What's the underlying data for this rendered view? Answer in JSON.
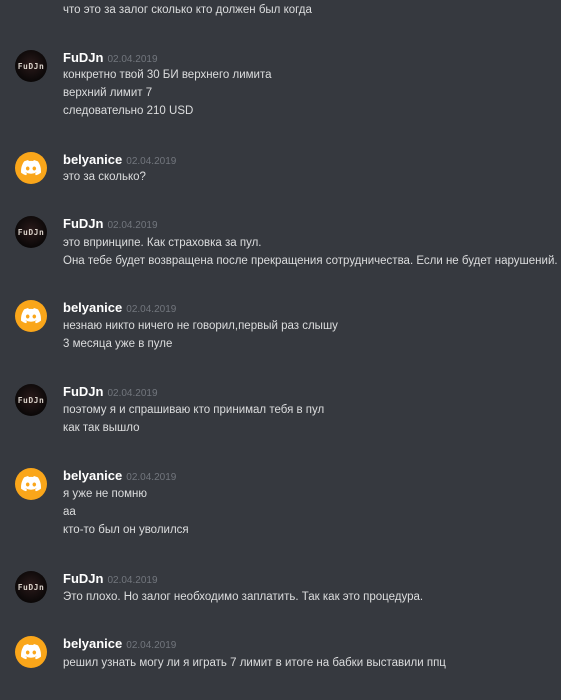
{
  "chat": {
    "top_partial_line": "что это за залог сколько кто должен был когда",
    "messages": [
      {
        "author": "FuDJn",
        "avatar_text": "FuDJn",
        "date": "02.04.2019",
        "lines": [
          "конкретно твой 30  БИ верхнего лимита",
          "верхний лимит 7",
          "следовательно 210 USD"
        ]
      },
      {
        "author": "belyanice",
        "avatar_icon": "discord-logo-icon",
        "date": "02.04.2019",
        "lines": [
          "это за сколько?"
        ]
      },
      {
        "author": "FuDJn",
        "avatar_text": "FuDJn",
        "date": "02.04.2019",
        "lines": [
          "это впринципе. Как страховка за пул.",
          "Она тебе будет возвращена после прекращения сотрудничества. Если не будет нарушений."
        ]
      },
      {
        "author": "belyanice",
        "avatar_icon": "discord-logo-icon",
        "date": "02.04.2019",
        "lines": [
          "незнаю никто ничего не говорил,первый раз слышу",
          "3 месяца уже в пуле"
        ]
      },
      {
        "author": "FuDJn",
        "avatar_text": "FuDJn",
        "date": "02.04.2019",
        "lines": [
          "поэтому я и спрашиваю кто принимал тебя в пул",
          "как так вышло"
        ]
      },
      {
        "author": "belyanice",
        "avatar_icon": "discord-logo-icon",
        "date": "02.04.2019",
        "lines": [
          "я уже не помню",
          "аа",
          "кто-то был он уволился"
        ]
      },
      {
        "author": "FuDJn",
        "avatar_text": "FuDJn",
        "date": "02.04.2019",
        "lines": [
          "Это плохо. Но залог необходимо заплатить. Так как это процедура."
        ]
      },
      {
        "author": "belyanice",
        "avatar_icon": "discord-logo-icon",
        "date": "02.04.2019",
        "lines": [
          "решил узнать могу ли я играть 7 лимит в итоге на бабки выставили ппц"
        ]
      }
    ]
  },
  "colors": {
    "background": "#36393f",
    "username": "#ffffff",
    "timestamp": "#72767d",
    "text": "#dcddde",
    "discord_avatar": "#faa61a"
  }
}
